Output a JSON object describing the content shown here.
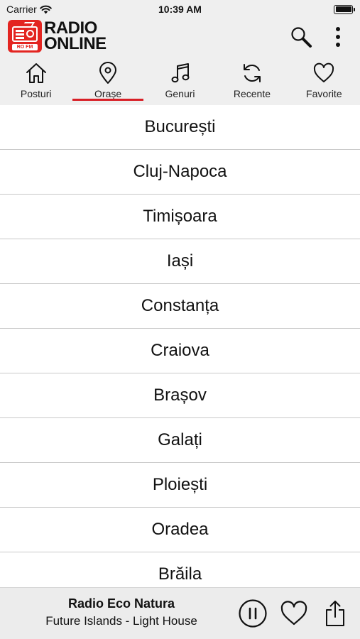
{
  "status": {
    "carrier": "Carrier",
    "time": "10:39 AM"
  },
  "header": {
    "logo_line1": "RADIO",
    "logo_line2": "ONLINE",
    "logo_sub": "RO FM",
    "icons": [
      "search-icon",
      "more-vertical-icon"
    ]
  },
  "tabs": [
    {
      "label": "Posturi",
      "icon": "home-icon",
      "active": false
    },
    {
      "label": "Orașe",
      "icon": "location-pin-icon",
      "active": true
    },
    {
      "label": "Genuri",
      "icon": "music-note-icon",
      "active": false
    },
    {
      "label": "Recente",
      "icon": "refresh-icon",
      "active": false
    },
    {
      "label": "Favorite",
      "icon": "heart-icon",
      "active": false
    }
  ],
  "cities": [
    "București",
    "Cluj-Napoca",
    "Timișoara",
    "Iași",
    "Constanța",
    "Craiova",
    "Brașov",
    "Galați",
    "Ploiești",
    "Oradea",
    "Brăila"
  ],
  "player": {
    "station": "Radio Eco Natura",
    "track": "Future Islands - Light House",
    "icons": [
      "pause-icon",
      "heart-icon",
      "share-icon"
    ]
  },
  "colors": {
    "accent": "#d81f26",
    "logo_red": "#e32521",
    "background": "#efefef",
    "list_background": "#ffffff"
  }
}
